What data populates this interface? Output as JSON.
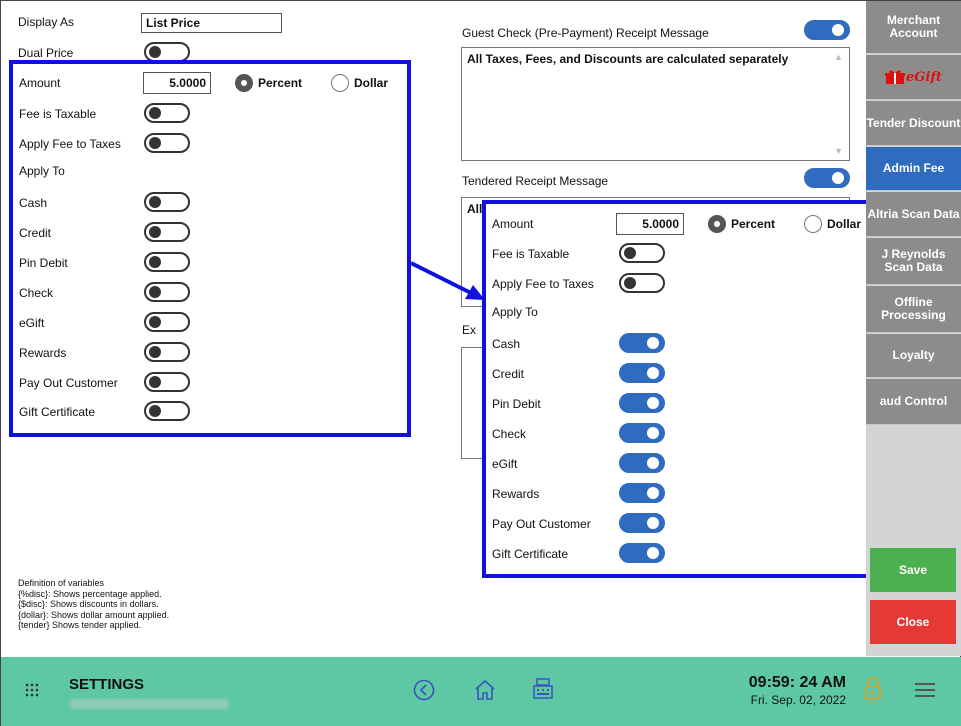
{
  "left": {
    "display_as_label": "Display As",
    "display_as_value": "List Price",
    "dual_price_label": "Dual Price",
    "amount_label": "Amount",
    "amount_value": "5.0000",
    "percent_label": "Percent",
    "dollar_label": "Dollar",
    "fee_taxable_label": "Fee is Taxable",
    "apply_fee_label": "Apply Fee to Taxes",
    "apply_to_label": "Apply To",
    "tenders": [
      "Cash",
      "Credit",
      "Pin Debit",
      "Check",
      "eGift",
      "Rewards",
      "Pay Out Customer",
      "Gift Certificate"
    ]
  },
  "middle": {
    "guest_check_label": "Guest Check (Pre-Payment) Receipt Message",
    "guest_check_text": "All Taxes, Fees, and Discounts are calculated separately",
    "tendered_label": "Tendered Receipt Message",
    "tendered_text_partial": "All",
    "ex_label": "Ex"
  },
  "zoom": {
    "amount_label": "Amount",
    "amount_value": "5.0000",
    "percent_label": "Percent",
    "dollar_label": "Dollar",
    "fee_taxable_label": "Fee is Taxable",
    "apply_fee_label": "Apply Fee to Taxes",
    "apply_to_label": "Apply To",
    "tenders": [
      "Cash",
      "Credit",
      "Pin Debit",
      "Check",
      "eGift",
      "Rewards",
      "Pay Out Customer",
      "Gift Certificate"
    ]
  },
  "sidebar": {
    "merchant": "Merchant Account",
    "egift": "eGift",
    "tender_discount": "Tender Discount",
    "admin_fee": "Admin Fee",
    "altria": "Altria Scan Data",
    "rj": "J Reynolds Scan Data",
    "offline": "Offline Processing",
    "loyalty": "Loyalty",
    "fraud": "aud Control",
    "save": "Save",
    "close": "Close"
  },
  "definitions": [
    "Definition of variables",
    "{%disc}: Shows percentage applied.",
    "{$disc}:  Shows discounts in dollars.",
    "{dollar}: Shows dollar amount applied.",
    "{tender} Shows tender applied."
  ],
  "footer": {
    "title": "SETTINGS",
    "time": "09:59: 24 AM",
    "date": "Fri. Sep. 02, 2022"
  },
  "colors": {
    "accent_blue": "#2f6cc0",
    "highlight_blue": "#1010e0",
    "footer_green": "#5dc7a6",
    "save_green": "#4caf50",
    "close_red": "#e53935"
  },
  "icons": [
    "grid-menu-icon",
    "back-circle-icon",
    "home-icon",
    "register-icon",
    "lock-icon",
    "hamburger-icon",
    "gift-icon"
  ]
}
